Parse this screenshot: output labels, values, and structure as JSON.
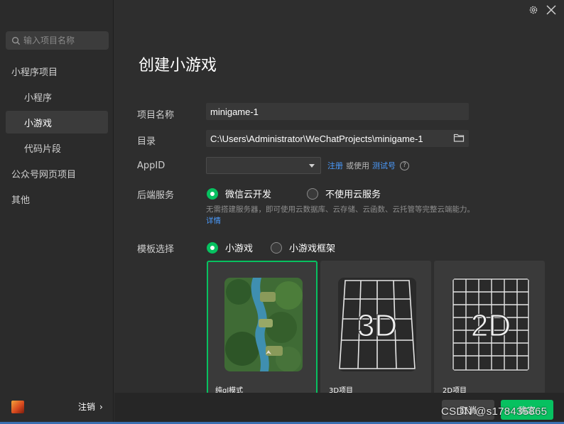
{
  "sidebar": {
    "search_placeholder": "输入项目名称",
    "items": [
      {
        "label": "小程序项目"
      },
      {
        "label": "小程序"
      },
      {
        "label": "小游戏"
      },
      {
        "label": "代码片段"
      },
      {
        "label": "公众号网页项目"
      },
      {
        "label": "其他"
      }
    ],
    "logout_label": "注销",
    "logout_chevron": "›"
  },
  "header": {
    "title": "创建小游戏"
  },
  "form": {
    "project_name_label": "项目名称",
    "project_name_value": "minigame-1",
    "dir_label": "目录",
    "dir_value": "C:\\Users\\Administrator\\WeChatProjects\\minigame-1",
    "appid_label": "AppID",
    "appid_register": "注册",
    "appid_or_use": "或使用",
    "appid_test": "测试号",
    "help_glyph": "?",
    "backend_label": "后端服务",
    "backend_options": [
      "微信云开发",
      "不使用云服务"
    ],
    "backend_desc": "无需搭建服务器，即可使用云数据库、云存储、云函数、云托管等完整云端能力。",
    "backend_detail_link": "详情",
    "template_label": "模板选择",
    "template_options": [
      "小游戏",
      "小游戏框架"
    ]
  },
  "templates": [
    {
      "caption": "纯gl模式"
    },
    {
      "caption": "3D项目",
      "glyph": "3D"
    },
    {
      "caption": "2D项目",
      "glyph": "2D"
    }
  ],
  "footer": {
    "cancel_label": "取消",
    "ok_label": "确定"
  },
  "watermark": "CSDN @s178435865",
  "colors": {
    "accent": "#07c160",
    "link": "#4b9cff",
    "background": "#2e2e2e"
  }
}
